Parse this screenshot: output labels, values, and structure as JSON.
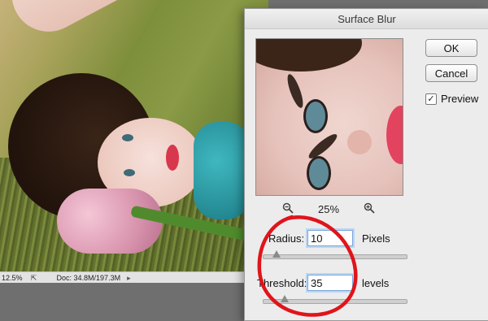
{
  "status_bar": {
    "zoom": "12.5%",
    "doc_info": "Doc: 34.8M/197.3M"
  },
  "dialog": {
    "title": "Surface Blur",
    "ok_label": "OK",
    "cancel_label": "Cancel",
    "preview_label": "Preview",
    "preview_checked": true,
    "zoom_level": "25%",
    "radius": {
      "label": "Radius:",
      "value": "10",
      "unit": "Pixels",
      "slider_fraction": 0.06
    },
    "threshold": {
      "label": "Threshold:",
      "value": "35",
      "unit": "levels",
      "slider_fraction": 0.12
    }
  },
  "colors": {
    "annotation_red": "#e0141b",
    "field_focus_blue": "#7aa7d8"
  },
  "icons": {
    "zoom_out": "zoom-out-icon",
    "zoom_in": "zoom-in-icon",
    "export": "export-icon",
    "arrow": "arrow-right-icon"
  }
}
